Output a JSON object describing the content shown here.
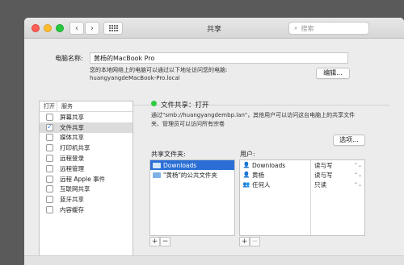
{
  "window": {
    "title": "共享"
  },
  "search": {
    "placeholder": "搜索"
  },
  "computer_name": {
    "label": "电脑名称:",
    "value": "黄杨的MacBook Pro",
    "info_line": "您的本地网络上的电脑可以通过以下地址访问您的电脑:",
    "address": "huangyangdeMacBook-Pro.local",
    "edit_button": "编辑..."
  },
  "services": {
    "header_on": "打开",
    "header_service": "服务",
    "items": [
      {
        "label": "屏幕共享",
        "checked": false
      },
      {
        "label": "文件共享",
        "checked": true
      },
      {
        "label": "媒体共享",
        "checked": false
      },
      {
        "label": "打印机共享",
        "checked": false
      },
      {
        "label": "远程登录",
        "checked": false
      },
      {
        "label": "远程管理",
        "checked": false
      },
      {
        "label": "远程 Apple 事件",
        "checked": false
      },
      {
        "label": "互联网共享",
        "checked": false
      },
      {
        "label": "蓝牙共享",
        "checked": false
      },
      {
        "label": "内容缓存",
        "checked": false
      }
    ]
  },
  "file_sharing": {
    "status": "文件共享：打开",
    "status_color": "#2ecc40",
    "description_1": "通过\"smb://huangyangdembp.lan\"，其他用户可以访问这台电脑上的共享文件",
    "description_2": "夹、管理员可以访问所有宗卷",
    "options_button": "选项...",
    "shared_folders_label": "共享文件夹:",
    "users_label": "用户:",
    "folders": [
      {
        "name": "Downloads",
        "selected": true
      },
      {
        "name": "\"黄杨\"的公共文件夹",
        "selected": false
      }
    ],
    "users": [
      {
        "name": "Downloads",
        "icon": "person-icon",
        "permission": "读与写"
      },
      {
        "name": "黄杨",
        "icon": "person-icon",
        "permission": "读与写"
      },
      {
        "name": "任何人",
        "icon": "group-icon",
        "permission": "只读"
      }
    ],
    "add_label": "+",
    "remove_label": "−"
  },
  "colors": {
    "selection": "#2b6fd6",
    "check": "#2f6fd8"
  }
}
